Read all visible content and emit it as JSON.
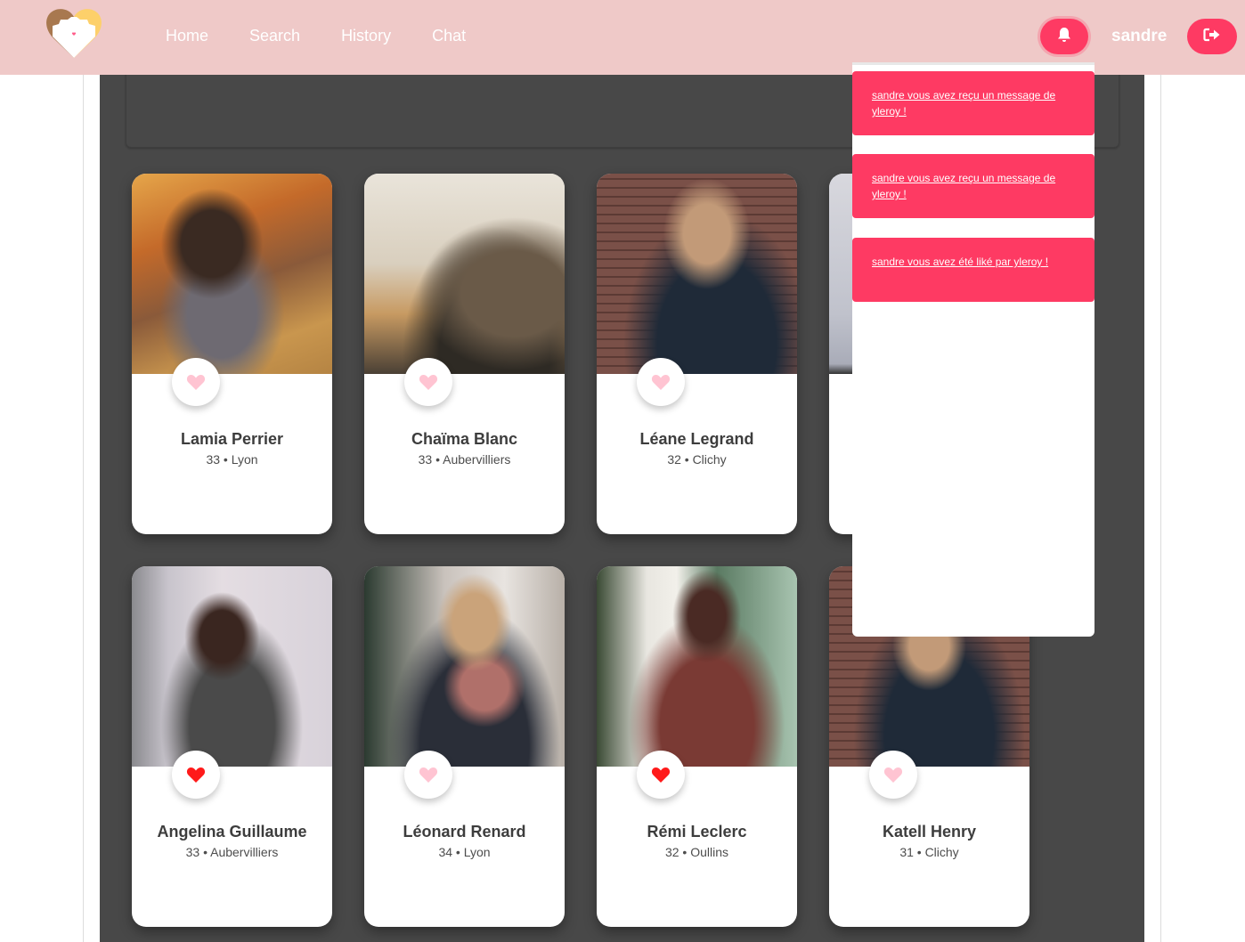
{
  "navbar": {
    "logo_alt": "heart-logo",
    "links": [
      {
        "label": "Home"
      },
      {
        "label": "Search"
      },
      {
        "label": "History"
      },
      {
        "label": "Chat"
      }
    ],
    "notifications_icon": "bell-icon",
    "username": "sandre",
    "logout_icon": "sign-out-icon",
    "accent_color": "#fe3a63",
    "background_color": "#efc9c8"
  },
  "notifications": {
    "items": [
      {
        "text": "sandre vous avez reçu un message de yleroy !"
      },
      {
        "text": "sandre vous avez reçu un message de yleroy !"
      },
      {
        "text": "sandre vous avez été liké par yleroy !"
      }
    ]
  },
  "profiles": [
    {
      "name": "Lamia Perrier",
      "age": "33",
      "city": "Lyon",
      "info": "33 • Lyon",
      "liked": false
    },
    {
      "name": "Chaïma Blanc",
      "age": "33",
      "city": "Aubervilliers",
      "info": "33 • Aubervilliers",
      "liked": false
    },
    {
      "name": "Léane Legrand",
      "age": "32",
      "city": "Clichy",
      "info": "32 • Clichy",
      "liked": false
    },
    {
      "name": "",
      "age": "",
      "city": "",
      "info": "",
      "liked": false
    },
    {
      "name": "Angelina Guillaume",
      "age": "33",
      "city": "Aubervilliers",
      "info": "33 • Aubervilliers",
      "liked": true
    },
    {
      "name": "Léonard Renard",
      "age": "34",
      "city": "Lyon",
      "info": "34 • Lyon",
      "liked": false
    },
    {
      "name": "Rémi Leclerc",
      "age": "32",
      "city": "Oullins",
      "info": "32 • Oullins",
      "liked": true
    },
    {
      "name": "Katell Henry",
      "age": "31",
      "city": "Clichy",
      "info": "31 • Clichy",
      "liked": false
    }
  ],
  "like_colors": {
    "liked": "#ff1a1a",
    "not_liked": "#ffc4d2"
  }
}
